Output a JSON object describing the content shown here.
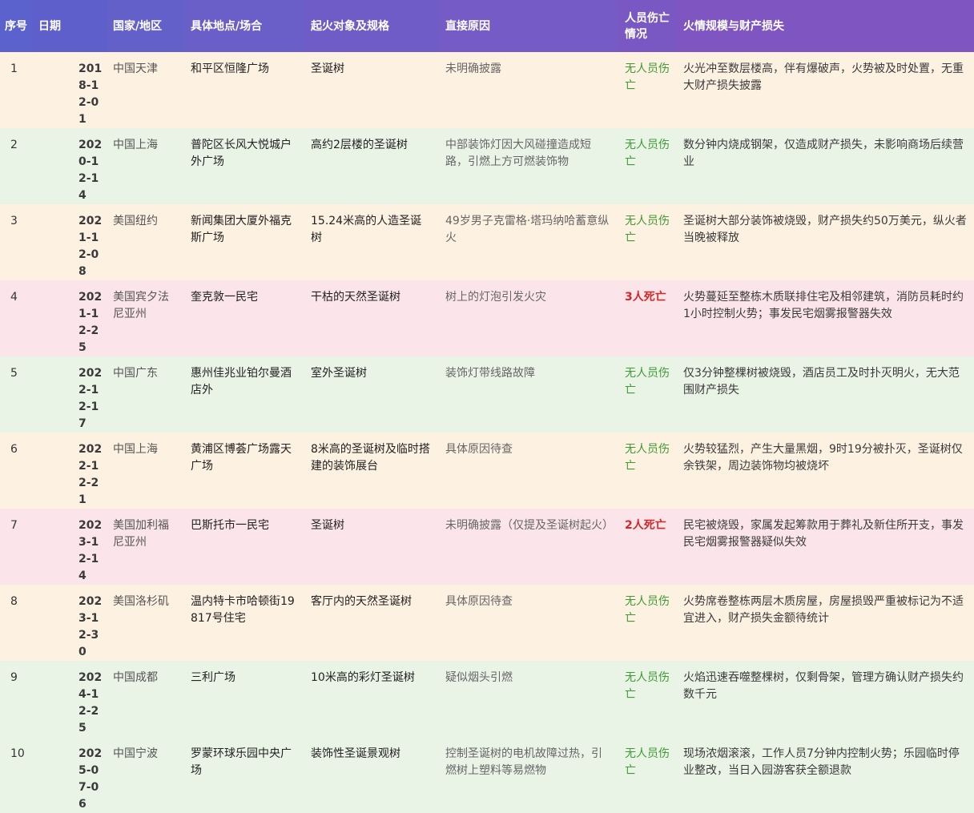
{
  "header": {
    "index": "序号",
    "date": "日期",
    "region": "国家/地区",
    "place": "具体地点/场合",
    "object": "起火对象及规格",
    "cause": "直接原因",
    "casualty": "人员伤亡情况",
    "loss": "火情规模与财产损失"
  },
  "colors": {
    "header_gradient_start": "#5b62cd",
    "header_gradient_end": "#7f56c1",
    "row_peach": "#fdf1e1",
    "row_mint": "#e9f4e6",
    "row_pink": "#fce5ea",
    "no_casualty_green": "#3f9a35",
    "death_red": "#cf2a2a"
  },
  "rows": [
    {
      "index": "1",
      "date": "2018-12-01",
      "region": "中国天津",
      "place": "和平区恒隆广场",
      "object": "圣诞树",
      "cause": "未明确披露",
      "casualty": "无人员伤亡",
      "casualty_type": "ok",
      "loss": "火光冲至数层楼高，伴有爆破声，火势被及时处置，无重大财产损失披露",
      "bg": "peach"
    },
    {
      "index": "2",
      "date": "2020-12-14",
      "region": "中国上海",
      "place": "普陀区长风大悦城户外广场",
      "object": "高约2层楼的圣诞树",
      "cause": "中部装饰灯因大风碰撞造成短路，引燃上方可燃装饰物",
      "casualty": "无人员伤亡",
      "casualty_type": "ok",
      "loss": "数分钟内烧成钢架，仅造成财产损失，未影响商场后续营业",
      "bg": "mint"
    },
    {
      "index": "3",
      "date": "2021-12-08",
      "region": "美国纽约",
      "place": "新闻集团大厦外福克斯广场",
      "object": "15.24米高的人造圣诞树",
      "cause": "49岁男子克雷格·塔玛纳哈蓄意纵火",
      "casualty": "无人员伤亡",
      "casualty_type": "ok",
      "loss": "圣诞树大部分装饰被烧毁，财产损失约50万美元，纵火者当晚被释放",
      "bg": "peach"
    },
    {
      "index": "4",
      "date": "2021-12-25",
      "region": "美国宾夕法尼亚州",
      "place": "奎克敦一民宅",
      "object": "干枯的天然圣诞树",
      "cause": "树上的灯泡引发火灾",
      "casualty": "3人死亡",
      "casualty_type": "dead",
      "loss": "火势蔓延至整栋木质联排住宅及相邻建筑，消防员耗时约1小时控制火势；事发民宅烟雾报警器失效",
      "bg": "pink"
    },
    {
      "index": "5",
      "date": "2022-12-17",
      "region": "中国广东",
      "place": "惠州佳兆业铂尔曼酒店外",
      "object": "室外圣诞树",
      "cause": "装饰灯带线路故障",
      "casualty": "无人员伤亡",
      "casualty_type": "ok",
      "loss": "仅3分钟整棵树被烧毁，酒店员工及时扑灭明火，无大范围财产损失",
      "bg": "mint"
    },
    {
      "index": "6",
      "date": "2022-12-21",
      "region": "中国上海",
      "place": "黄浦区博荟广场露天广场",
      "object": "8米高的圣诞树及临时搭建的装饰展台",
      "cause": "具体原因待查",
      "casualty": "无人员伤亡",
      "casualty_type": "ok",
      "loss": "火势较猛烈，产生大量黑烟，9时19分被扑灭，圣诞树仅余铁架，周边装饰物均被烧坏",
      "bg": "peach"
    },
    {
      "index": "7",
      "date": "2023-12-14",
      "region": "美国加利福尼亚州",
      "place": "巴斯托市一民宅",
      "object": "圣诞树",
      "cause": "未明确披露（仅提及圣诞树起火）",
      "casualty": "2人死亡",
      "casualty_type": "dead",
      "loss": "民宅被烧毁，家属发起筹款用于葬礼及新住所开支，事发民宅烟雾报警器疑似失效",
      "bg": "pink"
    },
    {
      "index": "8",
      "date": "2023-12-30",
      "region": "美国洛杉矶",
      "place": "温内特卡市哈顿街19817号住宅",
      "object": "客厅内的天然圣诞树",
      "cause": "具体原因待查",
      "casualty": "无人员伤亡",
      "casualty_type": "ok",
      "loss": "火势席卷整栋两层木质房屋，房屋损毁严重被标记为不适宜进入，财产损失金额待统计",
      "bg": "peach"
    },
    {
      "index": "9",
      "date": "2024-12-25",
      "region": "中国成都",
      "place": "三利广场",
      "object": "10米高的彩灯圣诞树",
      "cause": "疑似烟头引燃",
      "casualty": "无人员伤亡",
      "casualty_type": "ok",
      "loss": "火焰迅速吞噬整棵树，仅剩骨架，管理方确认财产损失约数千元",
      "bg": "mint"
    },
    {
      "index": "10",
      "date": "2025-07-06",
      "region": "中国宁波",
      "place": "罗蒙环球乐园中央广场",
      "object": "装饰性圣诞景观树",
      "cause": "控制圣诞树的电机故障过热，引燃树上塑料等易燃物",
      "casualty": "无人员伤亡",
      "casualty_type": "ok",
      "loss": "现场浓烟滚滚，工作人员7分钟内控制火势；乐园临时停业整改，当日入园游客获全额退款",
      "bg": "mint"
    }
  ]
}
